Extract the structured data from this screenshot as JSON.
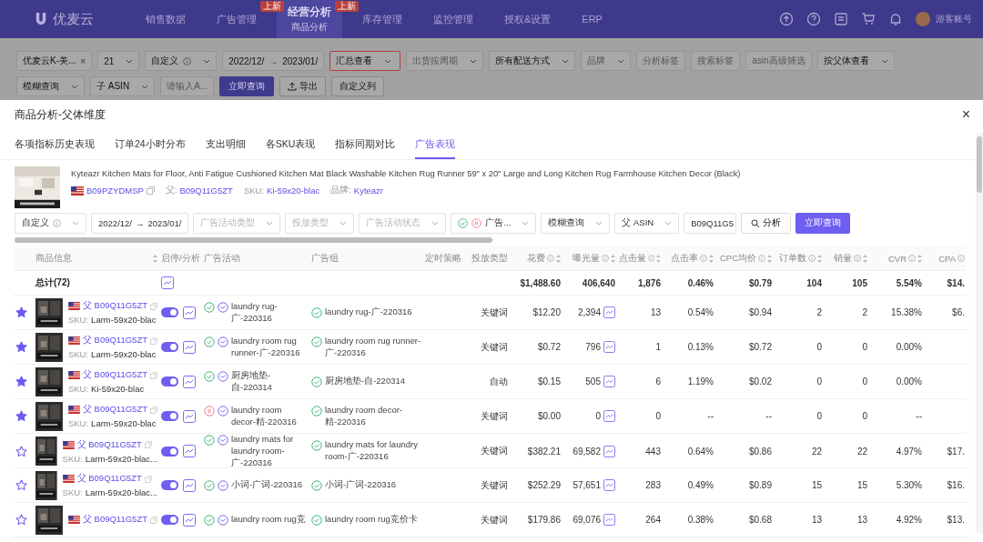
{
  "app": {
    "logo": "优麦云",
    "nav": [
      {
        "label": "销售数据",
        "selected": false
      },
      {
        "label": "广告管理",
        "selected": false,
        "badge": "上新"
      },
      {
        "label": "经营分析",
        "selected": true,
        "sub": "商品分析",
        "badge": "上新"
      },
      {
        "label": "库存管理",
        "selected": false
      },
      {
        "label": "监控管理",
        "selected": false
      },
      {
        "label": "授权&设置",
        "selected": false
      },
      {
        "label": "ERP",
        "selected": false
      }
    ],
    "user": "游客账号"
  },
  "filters": {
    "row1": [
      {
        "kind": "chip",
        "value": "优麦云K-美...",
        "close": "×"
      },
      {
        "kind": "select",
        "value": "21"
      },
      {
        "kind": "select",
        "value": "自定义",
        "info": true
      },
      {
        "kind": "range",
        "from": "2022/12/",
        "arrow": "→",
        "to": "2023/01/"
      },
      {
        "kind": "select",
        "value": "汇总查看",
        "alert": true
      },
      {
        "kind": "select",
        "placeholder": "出货按周期"
      },
      {
        "kind": "select",
        "value": "所有配送方式"
      },
      {
        "kind": "select",
        "placeholder": "品牌"
      },
      {
        "kind": "input",
        "placeholder": "分析标签"
      },
      {
        "kind": "input",
        "placeholder": "搜索标签"
      },
      {
        "kind": "input",
        "placeholder": "asin高级筛选"
      },
      {
        "kind": "select",
        "value": "按父体查看"
      }
    ],
    "row2": [
      {
        "kind": "select",
        "value": "模糊查询"
      },
      {
        "kind": "select",
        "value": "子 ASIN"
      },
      {
        "kind": "input",
        "placeholder": "请输入A..."
      },
      {
        "kind": "primary",
        "value": "立即查询"
      },
      {
        "kind": "export",
        "value": "导出"
      },
      {
        "kind": "plain",
        "value": "自定义列"
      }
    ]
  },
  "modal": {
    "title": "商品分析-父体维度",
    "close": "×",
    "tabs": [
      {
        "label": "各项指标历史表现",
        "selected": false
      },
      {
        "label": "订单24小时分布",
        "selected": false
      },
      {
        "label": "支出明细",
        "selected": false
      },
      {
        "label": "各SKU表现",
        "selected": false
      },
      {
        "label": "指标同期对比",
        "selected": false
      },
      {
        "label": "广告表现",
        "selected": true
      }
    ],
    "product": {
      "title": "Kyteazr Kitchen Mats for Floor, Anti Fatigue Cushioned Kitchen Mat Black Washable Kitchen Rug Runner 59\" x 20\" Large and Long Kitchen Rug Farmhouse Kitchen Decor (Black)",
      "asin": "B09PZYDMSP",
      "meta": [
        {
          "label": "父:",
          "value": "B09Q11G5ZT"
        },
        {
          "label": "SKU:",
          "value": "Ki-59x20-blac"
        },
        {
          "label": "品牌:",
          "value": "Kyteazr"
        }
      ]
    },
    "filters": [
      {
        "kind": "select",
        "value": "自定义",
        "info": true
      },
      {
        "kind": "range",
        "from": "2022/12/",
        "arrow": "→",
        "to": "2023/01/"
      },
      {
        "kind": "select",
        "placeholder": "广告活动类型"
      },
      {
        "kind": "select",
        "placeholder": "投放类型"
      },
      {
        "kind": "select",
        "placeholder": "广告活动状态"
      },
      {
        "kind": "status",
        "value": "广告..."
      },
      {
        "kind": "select",
        "value": "模糊查询"
      },
      {
        "kind": "select",
        "value": "父 ASIN"
      },
      {
        "kind": "input",
        "value": "B09Q11G5"
      },
      {
        "kind": "analyze",
        "value": "分析"
      },
      {
        "kind": "primary",
        "value": "立即查询"
      }
    ],
    "columns": [
      {
        "label": "商品信息",
        "sort": true
      },
      {
        "label": "启停/分析"
      },
      {
        "label": "广告活动"
      },
      {
        "label": "广告组"
      },
      {
        "label": "定时策略",
        "info": true
      },
      {
        "label": "投放类型"
      },
      {
        "label": "花费",
        "info": true,
        "sort": true
      },
      {
        "label": "曝光量",
        "info": true,
        "sort": true
      },
      {
        "label": "点击量",
        "info": true,
        "sort": true
      },
      {
        "label": "点击率",
        "info": true,
        "sort": true
      },
      {
        "label": "CPC均价",
        "info": true,
        "sort": true
      },
      {
        "label": "订单数",
        "info": true,
        "sort": true
      },
      {
        "label": "销量",
        "info": true,
        "sort": true
      },
      {
        "label": "CVR",
        "info": true,
        "sort": true
      },
      {
        "label": "CPA",
        "info": true
      }
    ],
    "total": {
      "label": "总计(72)",
      "spend": "$1,488.60",
      "impressions": "406,640",
      "clicks": "1,876",
      "ctr": "0.46%",
      "cpc": "$0.79",
      "orders": "104",
      "units": "105",
      "cvr": "5.54%",
      "cpa": "$14."
    },
    "rows": [
      {
        "starred": true,
        "parent": "父 B09Q11G5ZT",
        "sku_label": "SKU:",
        "sku": "Larm-59x20-blac",
        "enabled": true,
        "campaign_paused": false,
        "campaign": "laundry rug-广-220316",
        "ad_group": "laundry rug-广-220316",
        "type": "关键词",
        "spend": "$12.20",
        "impressions": "2,394",
        "clicks": "13",
        "ctr": "0.54%",
        "cpc": "$0.94",
        "orders": "2",
        "units": "2",
        "cvr": "15.38%",
        "cpa": "$6."
      },
      {
        "starred": true,
        "parent": "父 B09Q11G5ZT",
        "sku_label": "SKU:",
        "sku": "Larm-59x20-blac",
        "enabled": true,
        "campaign_paused": false,
        "campaign": "laundry room rug runner-广-220316",
        "ad_group": "laundry room rug runner-广-220316",
        "type": "关键词",
        "spend": "$0.72",
        "impressions": "796",
        "clicks": "1",
        "ctr": "0.13%",
        "cpc": "$0.72",
        "orders": "0",
        "units": "0",
        "cvr": "0.00%"
      },
      {
        "starred": true,
        "parent": "父 B09Q11G5ZT",
        "sku_label": "SKU:",
        "sku": "Ki-59x20-blac",
        "enabled": true,
        "campaign_paused": false,
        "campaign": "厨房地垫-自-220314",
        "ad_group": "厨房地垫-自-220314",
        "type": "自动",
        "spend": "$0.15",
        "impressions": "505",
        "clicks": "6",
        "ctr": "1.19%",
        "cpc": "$0.02",
        "orders": "0",
        "units": "0",
        "cvr": "0.00%"
      },
      {
        "starred": true,
        "parent": "父 B09Q11G5ZT",
        "sku_label": "SKU:",
        "sku": "Larm-59x20-blac",
        "enabled": true,
        "campaign_paused": true,
        "campaign": "laundry room decor-精-220316",
        "ad_group": "laundry room decor-精-220316",
        "type": "关键词",
        "spend": "$0.00",
        "impressions": "0",
        "clicks": "0",
        "ctr": "--",
        "cpc": "--",
        "orders": "0",
        "units": "0",
        "cvr": "--"
      },
      {
        "starred": false,
        "parent": "父 B09Q11G5ZT",
        "sku_label": "SKU:",
        "sku": "Larm-59x20-blac...",
        "enabled": true,
        "campaign_paused": false,
        "campaign": "laundry mats for laundry room-广-220316",
        "ad_group": "laundry mats for laundry room-广-220316",
        "type": "关键词",
        "spend": "$382.21",
        "impressions": "69,582",
        "clicks": "443",
        "ctr": "0.64%",
        "cpc": "$0.86",
        "orders": "22",
        "units": "22",
        "cvr": "4.97%",
        "cpa": "$17."
      },
      {
        "starred": false,
        "parent": "父 B09Q11G5ZT",
        "sku_label": "SKU:",
        "sku": "Larm-59x20-blac...",
        "enabled": true,
        "campaign_paused": false,
        "campaign": "小词-广词-220316",
        "ad_group": "小词-广词-220316",
        "type": "关键词",
        "spend": "$252.29",
        "impressions": "57,651",
        "clicks": "283",
        "ctr": "0.49%",
        "cpc": "$0.89",
        "orders": "15",
        "units": "15",
        "cvr": "5.30%",
        "cpa": "$16."
      },
      {
        "starred": false,
        "parent": "父 B09Q11G5ZT",
        "enabled": true,
        "campaign_paused": false,
        "campaign": "laundry room rug竞",
        "ad_group": "laundry room rug竞价卡",
        "type": "关键词",
        "spend": "$179.86",
        "impressions": "69,076",
        "clicks": "264",
        "ctr": "0.38%",
        "cpc": "$0.68",
        "orders": "13",
        "units": "13",
        "cvr": "4.92%",
        "cpa": "$13."
      }
    ]
  }
}
